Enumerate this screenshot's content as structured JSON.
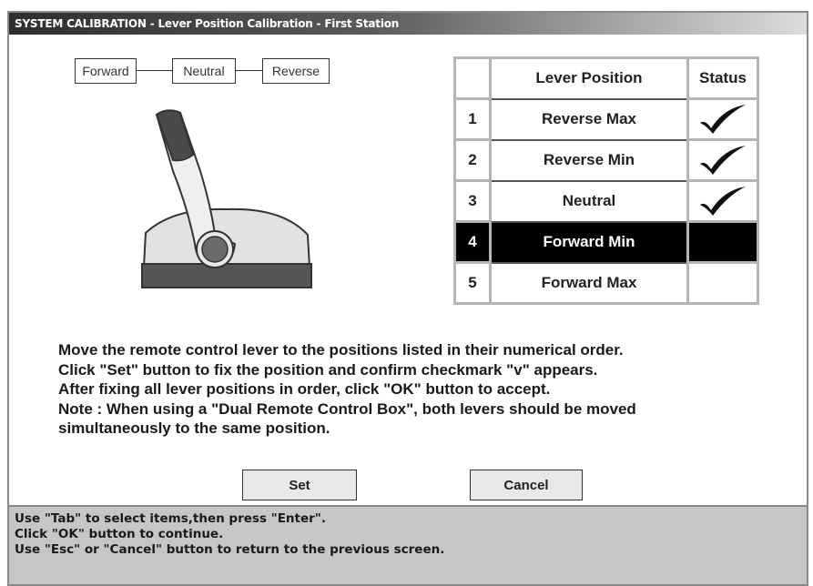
{
  "window": {
    "title": "SYSTEM CALIBRATION  - Lever Position Calibration - First Station"
  },
  "flow": {
    "forward": "Forward",
    "neutral": "Neutral",
    "reverse": "Reverse"
  },
  "table": {
    "header": {
      "number": "",
      "position": "Lever Position",
      "status": "Status"
    },
    "rows": [
      {
        "number": "1",
        "position": "Reverse Max",
        "status": "checkmark",
        "selected": false
      },
      {
        "number": "2",
        "position": "Reverse Min",
        "status": "checkmark",
        "selected": false
      },
      {
        "number": "3",
        "position": "Neutral",
        "status": "checkmark",
        "selected": false
      },
      {
        "number": "4",
        "position": "Forward Min",
        "status": "",
        "selected": true
      },
      {
        "number": "5",
        "position": "Forward Max",
        "status": "",
        "selected": false
      }
    ]
  },
  "instructions": {
    "line1": "Move the remote control lever to the positions listed in their numerical order.",
    "line2": "Click \"Set\" button to fix the position and confirm checkmark \"v\" appears.",
    "line3": "After fixing all lever positions in order, click \"OK\" button to accept.",
    "line4": "Note : When using a \"Dual Remote Control Box\", both levers should be moved",
    "line5": "simultaneously to the same position."
  },
  "buttons": {
    "set": "Set",
    "cancel": "Cancel"
  },
  "statusbar": {
    "line1": "Use \"Tab\" to select items,then press \"Enter\".",
    "line2": "Click \"OK\" button to continue.",
    "line3": "Use \"Esc\" or \"Cancel\" button to return to the previous screen."
  },
  "colors": {
    "selected_row_bg": "#000000",
    "statusbar_bg": "#c6c6c6"
  }
}
